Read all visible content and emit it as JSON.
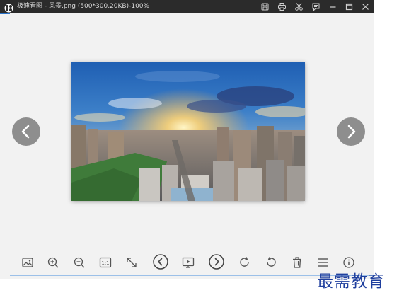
{
  "window": {
    "title": "极速看图 - 风景.png (500*300,20KB)-100%"
  },
  "titlebar_icons": [
    "save-icon",
    "print-icon",
    "crop-icon",
    "feedback-icon",
    "minimize-icon",
    "maximize-icon",
    "close-icon"
  ],
  "toolbar": {
    "items": [
      "image-icon",
      "zoom-in-icon",
      "zoom-out-icon",
      "actual-size-icon",
      "fullscreen-icon",
      "previous-icon",
      "slideshow-icon",
      "next-icon",
      "rotate-right-icon",
      "rotate-left-icon",
      "delete-icon",
      "menu-icon",
      "info-icon"
    ],
    "actual_size_label": "1:1"
  },
  "watermark": {
    "text": "最需教育"
  },
  "colors": {
    "titlebar": "#2b2b2b",
    "canvas": "#f2f2f2",
    "nav_button": "#8e8e8e",
    "watermark": "#1f3f9e"
  }
}
